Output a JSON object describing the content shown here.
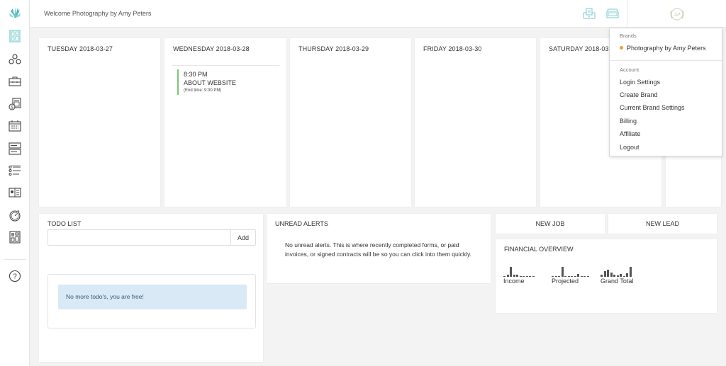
{
  "header": {
    "welcome": "Welcome Photography by Amy Peters",
    "icons": [
      "inbox-print-icon",
      "tray-icon"
    ],
    "brand_logo": "monogram-AP-logo"
  },
  "sidebar": {
    "logo": "lotus-logo",
    "items": [
      {
        "icon": "dashboard-icon",
        "active": true
      },
      {
        "icon": "contacts-icon"
      },
      {
        "icon": "briefcase-icon"
      },
      {
        "icon": "invoice-calculator-icon"
      },
      {
        "icon": "calendar-icon"
      },
      {
        "icon": "forms-icon"
      },
      {
        "icon": "task-list-icon"
      },
      {
        "icon": "contract-icon"
      },
      {
        "icon": "timer-icon"
      },
      {
        "icon": "layout-icon"
      },
      {
        "icon": "help-icon"
      }
    ]
  },
  "calendar": {
    "days": [
      {
        "label": "TUESDAY 2018-03-27",
        "events": []
      },
      {
        "label": "WEDNESDAY 2018-03-28",
        "events": [
          {
            "time": "8:30 PM",
            "title": "ABOUT WEBSITE",
            "end": "(End time: 9:30 PM)"
          }
        ]
      },
      {
        "label": "THURSDAY 2018-03-29",
        "events": []
      },
      {
        "label": "FRIDAY 2018-03-30",
        "events": []
      },
      {
        "label": "SATURDAY 2018-03-31",
        "events": []
      }
    ]
  },
  "todo": {
    "title": "TODO LIST",
    "input_value": "",
    "input_placeholder": "",
    "add_label": "Add",
    "empty_message": "No more todo's, you are free!"
  },
  "alerts": {
    "title": "UNREAD ALERTS",
    "message": "No unread alerts. This is where recently completed forms, or paid invoices, or signed contracts will be so you can click into them quickly."
  },
  "actions": {
    "new_job": "NEW JOB",
    "new_lead": "NEW LEAD"
  },
  "financial": {
    "title": "FINANCIAL OVERVIEW",
    "accent": "#555555",
    "charts": [
      {
        "label": "Income",
        "values": [
          0.05,
          0.2,
          1.0,
          0.25,
          0.25,
          0.05,
          0.05,
          0.05,
          0.1,
          0.05
        ]
      },
      {
        "label": "Projected",
        "values": [
          0.05,
          0.05,
          0.05,
          1.0,
          0.05,
          0.05,
          0.05,
          0.05,
          0.3,
          0.05,
          0.05,
          0.05
        ]
      },
      {
        "label": "Grand Total",
        "values": [
          0.2,
          0.6,
          0.75,
          0.45,
          0.25,
          0.15,
          0.3,
          0.05,
          0.35,
          1.0
        ]
      }
    ]
  },
  "dropdown": {
    "brands_heading": "Brands",
    "brand": {
      "name": "Photography by Amy Peters",
      "dot_color": "#f0a030"
    },
    "account_heading": "Account",
    "items": [
      "Login Settings",
      "Create Brand",
      "Current Brand Settings",
      "Billing",
      "Affiliate",
      "Logout"
    ]
  }
}
